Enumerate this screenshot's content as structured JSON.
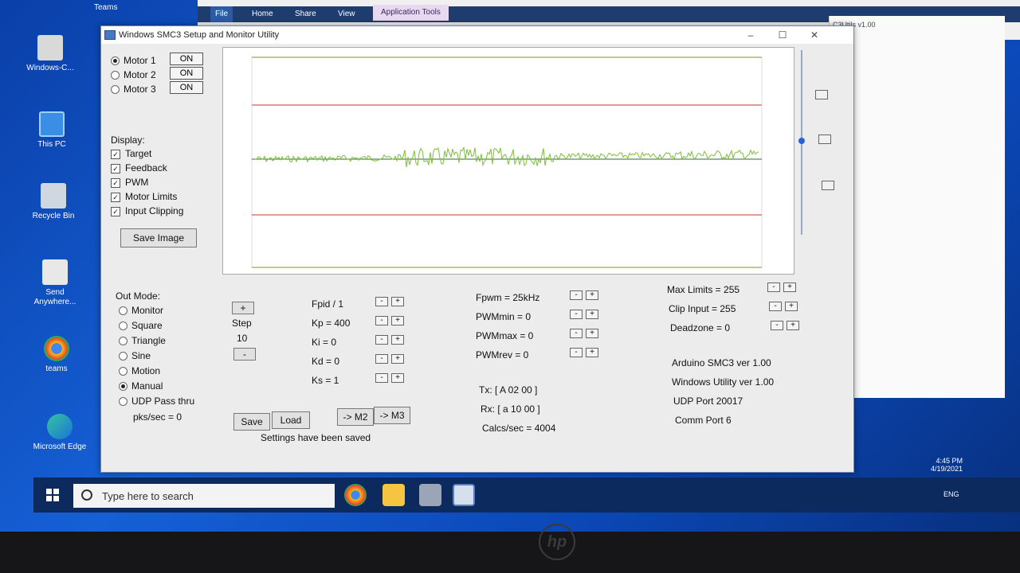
{
  "desktop": {
    "icons": [
      {
        "label": "Windows-C..."
      },
      {
        "label": "This PC"
      },
      {
        "label": "Recycle Bin"
      },
      {
        "label": "Send Anywhere..."
      },
      {
        "label": "teams"
      },
      {
        "label": "Microsoft Edge"
      }
    ],
    "top_label": "Teams"
  },
  "explorer": {
    "tabs": [
      "File",
      "Home",
      "Share",
      "View"
    ],
    "tools_tab": "Application Tools",
    "side_text": "C3Utils v1.00"
  },
  "window": {
    "title": "Windows SMC3 Setup and Monitor Utility",
    "controls": [
      "–",
      "☐",
      "✕"
    ],
    "motors": [
      {
        "label": "Motor 1",
        "state": "ON",
        "selected": true
      },
      {
        "label": "Motor 2",
        "state": "ON",
        "selected": false
      },
      {
        "label": "Motor 3",
        "state": "ON",
        "selected": false
      }
    ],
    "display_label": "Display:",
    "display_options": [
      "Target",
      "Feedback",
      "PWM",
      "Motor Limits",
      "Input Clipping"
    ],
    "save_image": "Save Image",
    "out_mode_label": "Out Mode:",
    "out_modes": [
      {
        "label": "Monitor",
        "selected": false
      },
      {
        "label": "Square",
        "selected": false
      },
      {
        "label": "Triangle",
        "selected": false
      },
      {
        "label": "Sine",
        "selected": false
      },
      {
        "label": "Motion",
        "selected": false
      },
      {
        "label": "Manual",
        "selected": true
      },
      {
        "label": "UDP Pass thru",
        "selected": false
      }
    ],
    "pks_sec": "pks/sec = 0",
    "step": {
      "plus": "+",
      "label": "Step",
      "value": "10",
      "minus": "-"
    },
    "pid": [
      "Fpid / 1",
      "Kp = 400",
      "Ki = 0",
      "Kd = 0",
      "Ks = 1"
    ],
    "pwm": [
      "Fpwm = 25kHz",
      "PWMmin = 0",
      "PWMmax = 0",
      "PWMrev = 0"
    ],
    "limits": [
      "Max Limits = 255",
      "Clip Input = 255",
      "Deadzone = 0"
    ],
    "pm_minus": "-",
    "pm_plus": "+",
    "tx": "Tx: [ A 02 00 ]",
    "rx": "Rx: [ a 10 00 ]",
    "calcs": "Calcs/sec = 4004",
    "info": [
      "Arduino SMC3 ver 1.00",
      "Windows Utility ver 1.00",
      "UDP Port 20017",
      "Comm Port 6"
    ],
    "buttons": {
      "save": "Save",
      "load": "Load",
      "m2": "-> M2",
      "m3": "-> M3"
    },
    "status": "Settings have been saved"
  },
  "taskbar": {
    "search_placeholder": "Type here to search",
    "tray_lang": "ENG",
    "time": "4:45 PM",
    "date": "4/19/2021"
  },
  "colors": {
    "signal": "#7dbf3a",
    "limit_line": "#c0392b",
    "baseline": "#2e6b2e",
    "frame_top": "#8b8b3a"
  }
}
